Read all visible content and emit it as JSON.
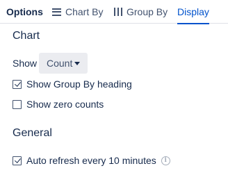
{
  "tabs": {
    "options": "Options",
    "chart_by": "Chart By",
    "group_by": "Group By",
    "display": "Display",
    "active": "display",
    "accent_color": "#0052cc"
  },
  "chart_section": {
    "title": "Chart",
    "show_label": "Show",
    "show_value": "Count",
    "options": [
      {
        "label": "Show Group By heading",
        "checked": true
      },
      {
        "label": "Show zero counts",
        "checked": false
      }
    ]
  },
  "general_section": {
    "title": "General",
    "options": [
      {
        "label": "Auto refresh every 10 minutes",
        "checked": true,
        "icon": "info-icon"
      }
    ]
  }
}
